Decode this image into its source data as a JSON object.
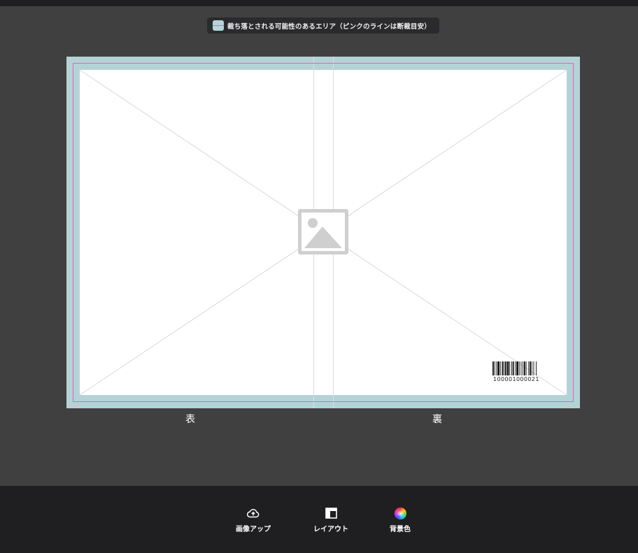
{
  "notice": {
    "text": "裁ち落とされる可能性のあるエリア（ピンクのラインは断裁目安）"
  },
  "pages": {
    "front_label": "表",
    "back_label": "裏"
  },
  "barcode": {
    "number": "100001000021"
  },
  "toolbar": {
    "upload_label": "画像アップ",
    "layout_label": "レイアウト",
    "bgcolor_label": "背景色"
  },
  "colors": {
    "app_background": "#404040",
    "toolbar_background": "#1f1f21",
    "bleed_area": "#b5d3d6",
    "trim_line": "#dd66bb",
    "placeholder_icon": "#cfcfcf"
  },
  "icons": {
    "notice": "bleed-swatch-icon",
    "placeholder": "image-placeholder-icon",
    "upload": "cloud-upload-icon",
    "layout": "layout-icon",
    "bgcolor": "color-wheel-icon"
  }
}
